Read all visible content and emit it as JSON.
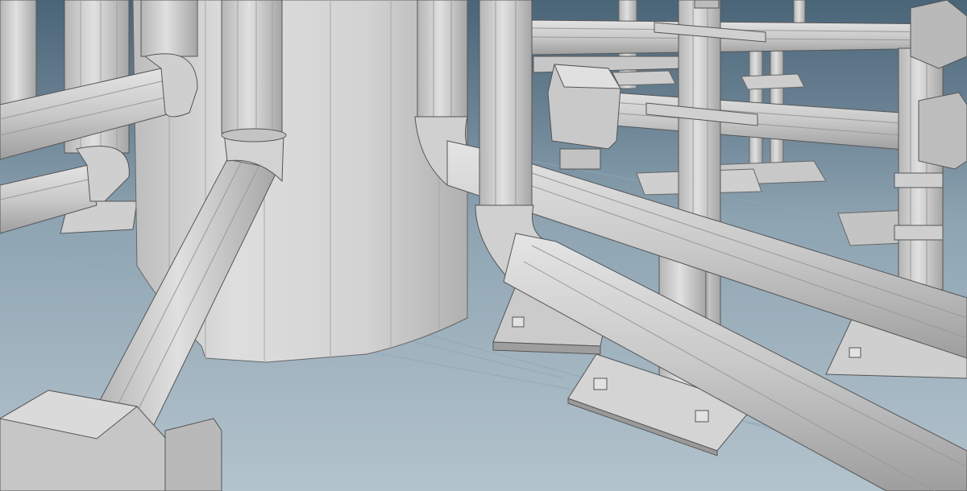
{
  "scene": {
    "colors": {
      "sky_top": "#4a6478",
      "sky_mid": "#7e95a4",
      "ground": "#aebfcb",
      "metal_light": "#d9d9d9",
      "metal_mid": "#bcbcbc",
      "metal_dark": "#8f8f8f",
      "edge": "#5a5a5a",
      "grid": "#8fa6b6"
    },
    "objects": [
      "cylindrical-tank",
      "pipe-elbow",
      "pipe-flange",
      "vertical-support-column",
      "base-plate",
      "anchor-bolt",
      "pipe-clamp-block"
    ]
  }
}
